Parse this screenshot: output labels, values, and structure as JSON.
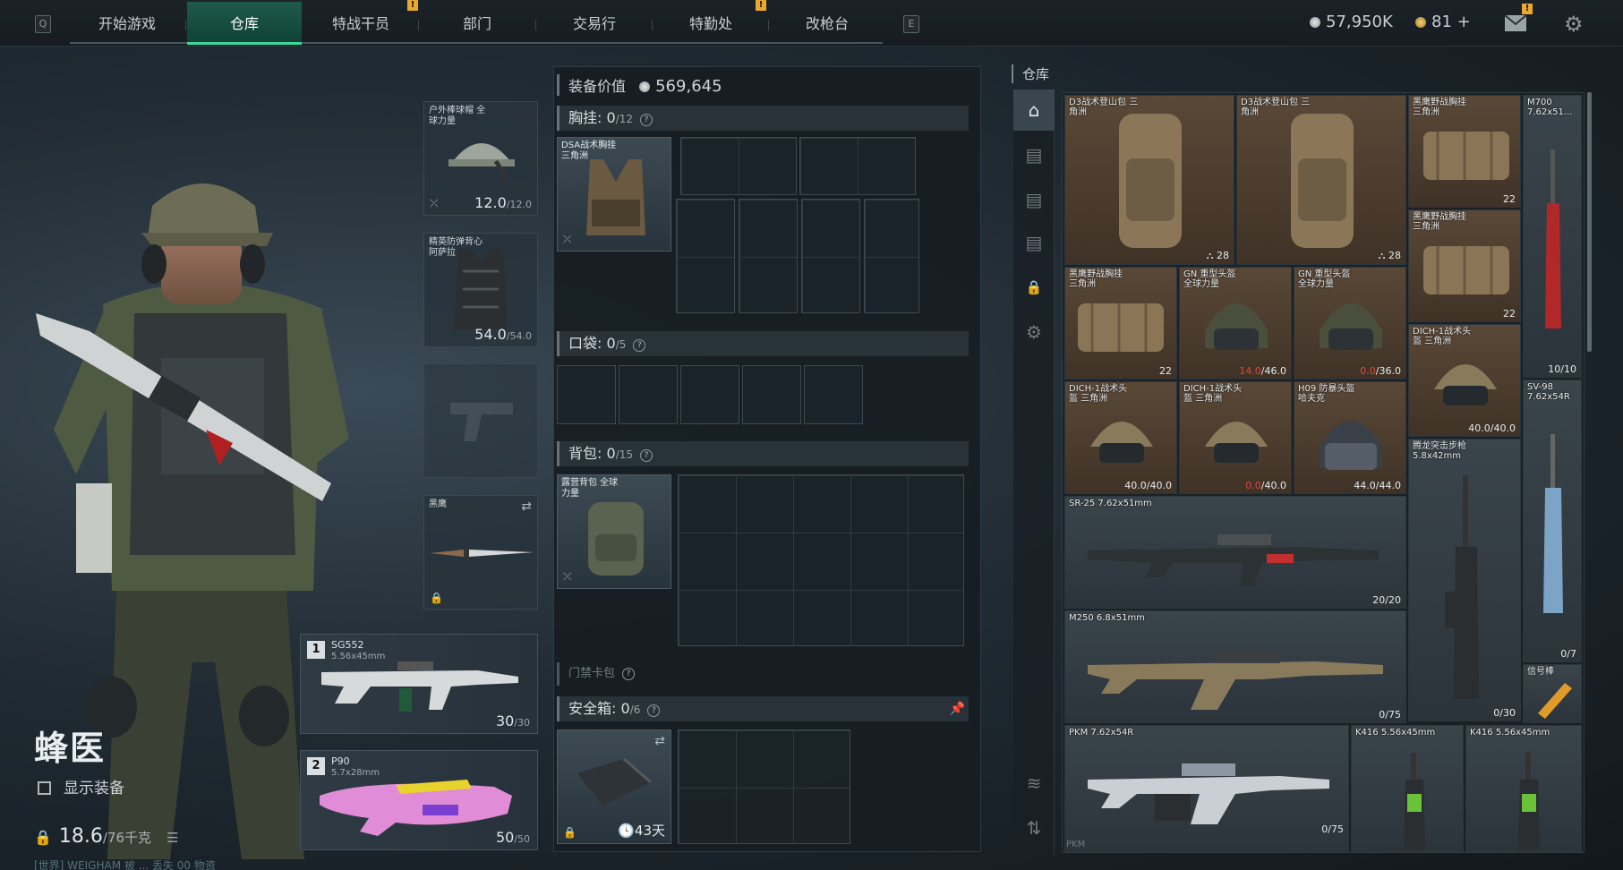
{
  "topbar": {
    "key_left": "Q",
    "key_right": "E",
    "tabs": [
      "开始游戏",
      "仓库",
      "特战干员",
      "部门",
      "交易行",
      "特勤处",
      "改枪台"
    ],
    "active_tab": "仓库",
    "alert_mark": "!",
    "currency_silver": "57,950K",
    "currency_gold": "81 +",
    "mail_badge": "!"
  },
  "character": {
    "name": "蜂医",
    "show_gear_label": "显示装备",
    "weight_value": "18.6",
    "weight_max": "/76千克",
    "bottom_text": "[世界] WEIGHAM 被 ... 丢失 00 物资"
  },
  "equip": {
    "helmet": {
      "name": "户外棒球帽 全球力量",
      "durability": "12.0",
      "durability_max": "/12.0"
    },
    "armor": {
      "name": "精英防弹背心 阿萨拉",
      "durability": "54.0",
      "durability_max": "/54.0"
    },
    "melee": {
      "name": "黑鹰"
    },
    "weapon1": {
      "num": "1",
      "name": "SG552",
      "caliber": "5.56x45mm",
      "ammo": "30",
      "ammo_max": "/30"
    },
    "weapon2": {
      "num": "2",
      "name": "P90",
      "caliber": "5.7x28mm",
      "ammo": "50",
      "ammo_max": "/50"
    }
  },
  "mid": {
    "value_label": "装备价值",
    "value": "569,645",
    "chest_label": "胸挂:",
    "chest_count": "0",
    "chest_cap": "/12",
    "chest_item": "DSA战术胸挂 三角洲",
    "pocket_label": "口袋:",
    "pocket_count": "0",
    "pocket_cap": "/5",
    "backpack_label": "背包:",
    "backpack_count": "0",
    "backpack_cap": "/15",
    "backpack_item": "露营背包 全球力量",
    "keycard_label": "门禁卡包",
    "safebox_label": "安全箱:",
    "safebox_count": "0",
    "safebox_cap": "/6",
    "safebox_time": "43天",
    "help": "?"
  },
  "warehouse": {
    "title": "仓库",
    "items": [
      {
        "name": "D3战术登山包 三角洲",
        "count": "28"
      },
      {
        "name": "D3战术登山包 三角洲",
        "count": "28"
      },
      {
        "name": "黑鹰野战胸挂 三角洲",
        "count": "22"
      },
      {
        "name": "M700 7.62x51...",
        "count": "10/10"
      },
      {
        "name": "黑鹰野战胸挂 三角洲",
        "count": "22"
      },
      {
        "name": "黑鹰野战胸挂 三角洲",
        "count": "22"
      },
      {
        "name": "GN 重型头盔 全球力量",
        "count_cur": "14.0",
        "count_max": "/46.0"
      },
      {
        "name": "GN 重型头盔 全球力量",
        "count_cur": "0.0",
        "count_max": "/36.0"
      },
      {
        "name": "DICH-1战术头盔 三角洲",
        "count": "40.0/40.0"
      },
      {
        "name": "DICH-1战术头盔 三角洲",
        "count": "40.0/40.0"
      },
      {
        "name": "DICH-1战术头盔 三角洲",
        "count_cur": "0.0",
        "count_max": "/40.0"
      },
      {
        "name": "H09 防暴头盔 哈夫克",
        "count": "44.0/44.0"
      },
      {
        "name": "SV-98 7.62x54R",
        "count": "0/7"
      },
      {
        "name": "腾龙突击步枪 5.8x42mm",
        "count": "0/30"
      },
      {
        "name": "SR-25 7.62x51mm",
        "count": "20/20"
      },
      {
        "name": "M250 6.8x51mm",
        "count": "0/75"
      },
      {
        "name": "信号棒",
        "count": ""
      },
      {
        "name": "PKM 7.62x54R",
        "count": "0/75"
      },
      {
        "name": "K416 5.56x45mm",
        "count": ""
      },
      {
        "name": "K416 5.56x45mm",
        "count": ""
      }
    ],
    "bottom_label": "PKM"
  }
}
